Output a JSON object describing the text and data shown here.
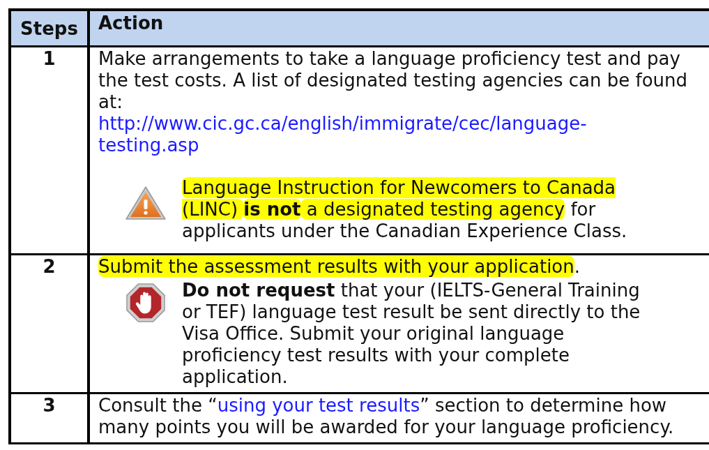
{
  "table": {
    "columns": [
      "Steps",
      "Action"
    ],
    "rows": [
      {
        "step": "1",
        "blocks": [
          {
            "kind": "paragraph",
            "segments": [
              {
                "kind": "text",
                "text": "Make arrangements to take a language proficiency test and pay the test costs. A list of designated testing agencies can be found at:"
              }
            ]
          },
          {
            "kind": "link",
            "text": "http://www.cic.gc.ca/english/immigrate/cec/language-testing.asp"
          },
          {
            "kind": "warning_note",
            "segments": [
              {
                "kind": "marked",
                "text": "Language Instruction for Newcomers to Canada (LINC) "
              },
              {
                "kind": "marked_strong",
                "text": "is not"
              },
              {
                "kind": "marked",
                "text": " a designated testing agency"
              },
              {
                "kind": "text",
                "text": " for applicants under the Canadian Experience Class."
              }
            ]
          }
        ]
      },
      {
        "step": "2",
        "blocks": [
          {
            "kind": "paragraph",
            "segments": [
              {
                "kind": "marked",
                "text": "Submit the assessment results with your application"
              },
              {
                "kind": "text",
                "text": "."
              }
            ]
          },
          {
            "kind": "stop_note",
            "segments": [
              {
                "kind": "strong",
                "text": "Do not request"
              },
              {
                "kind": "text",
                "text": " that your (IELTS-General Training or TEF) language test result be sent directly to the Visa Office. Submit your original language proficiency test results with your complete application."
              }
            ]
          }
        ]
      },
      {
        "step": "3",
        "blocks": [
          {
            "kind": "paragraph",
            "segments": [
              {
                "kind": "text",
                "text": "Consult the “"
              },
              {
                "kind": "link",
                "text": "using your test results"
              },
              {
                "kind": "text",
                "text": "” section to determine how many points you will be awarded for your language proficiency."
              }
            ]
          }
        ]
      }
    ]
  }
}
